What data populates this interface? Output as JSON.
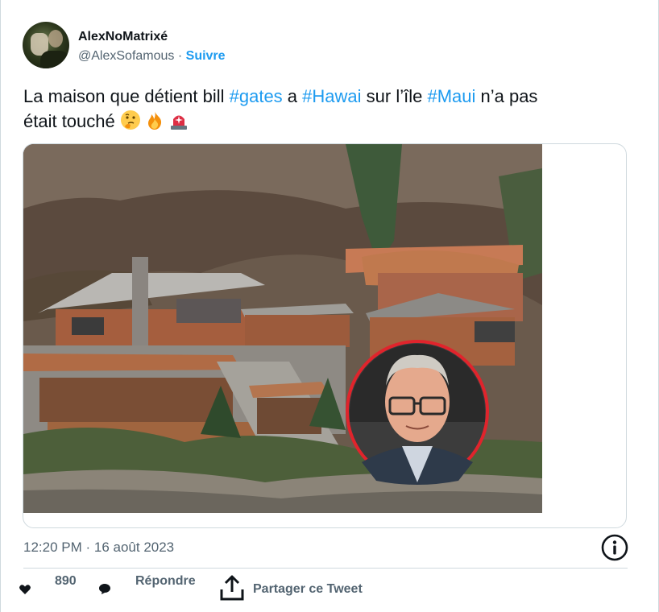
{
  "author": {
    "display_name": "AlexNoMatrixé",
    "handle": "@AlexSofamous",
    "separator": "·",
    "follow_label": "Suivre"
  },
  "tweet": {
    "line1_pre": "La maison que détient bill ",
    "tag_gates": "#gates",
    "line1_mid1": " a ",
    "tag_hawai": "#Hawai",
    "line1_mid2": " sur l’île ",
    "tag_maui": "#Maui",
    "line1_post": " n’a pas",
    "line2": "était touché ",
    "emojis": [
      "thinking-face",
      "fire",
      "police-light"
    ]
  },
  "meta": {
    "timestamp": "12:20 PM · 16 août 2023"
  },
  "actions": {
    "likes_count": "890",
    "reply_label": "Répondre",
    "share_label": "Partager ce Tweet"
  },
  "colors": {
    "accent": "#1d9bf0",
    "muted_text": "#536471",
    "border": "#cfd9de",
    "inset_ring": "#e0242c"
  }
}
